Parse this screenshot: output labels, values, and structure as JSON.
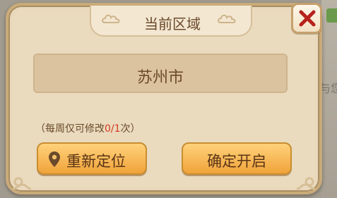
{
  "dialog": {
    "title": "当前区域",
    "location": "苏州市",
    "limit_note": {
      "prefix": "（每周仅可修改",
      "count": "0/1",
      "suffix": "次）"
    },
    "buttons": {
      "relocate": "重新定位",
      "confirm": "确定开启"
    }
  },
  "background": {
    "right_text": "与您"
  },
  "icons": {
    "close": "close-icon",
    "pin": "pin-icon"
  },
  "colors": {
    "accent_red": "#d43a24",
    "button_orange": "#f0a33a",
    "panel": "#e9d8bc"
  }
}
